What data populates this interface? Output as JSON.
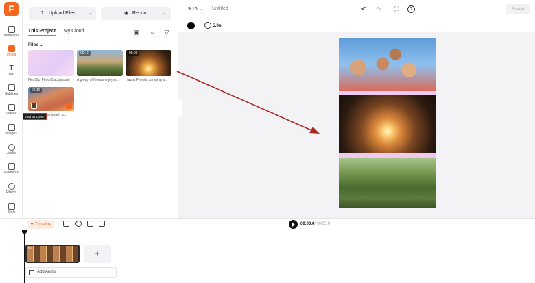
{
  "app": {
    "logo_letter": "F",
    "brand_color": "#f5671f"
  },
  "rail": {
    "items": [
      {
        "label": "Templates",
        "icon": "templates-icon"
      },
      {
        "label": "Media",
        "icon": "media-icon",
        "active": true
      },
      {
        "label": "Text",
        "icon": "text-icon"
      },
      {
        "label": "Subtitles",
        "icon": "subtitles-icon"
      },
      {
        "label": "Videos",
        "icon": "videos-icon"
      },
      {
        "label": "Images",
        "icon": "images-icon"
      },
      {
        "label": "Audio",
        "icon": "audio-icon"
      },
      {
        "label": "Elements",
        "icon": "elements-icon"
      },
      {
        "label": "Effects",
        "icon": "effects-icon"
      },
      {
        "label": "Tools",
        "icon": "tools-icon"
      }
    ]
  },
  "panel": {
    "upload_label": "Upload Files",
    "record_label": "Record",
    "tabs": [
      "This Project",
      "My Cloud"
    ],
    "files_label": "Files",
    "files": [
      {
        "caption": "FlexClip Photo Background",
        "duration": ""
      },
      {
        "caption": "A group of friends enjoym...",
        "duration": "00:12"
      },
      {
        "caption": "Happy Friends Jumping a...",
        "duration": "00:09"
      },
      {
        "caption": "...oying beach fu...",
        "duration": "00:10"
      }
    ],
    "tooltip": "Add as Layer"
  },
  "topbar": {
    "ratio": "9:16",
    "title": "Untitled",
    "saved_label": "Saved"
  },
  "subbar": {
    "duration": "5.0s",
    "bg_color": "#000000"
  },
  "timeline": {
    "label": "Timeline",
    "current_time": "00:00.0",
    "total_time": "/ 00:05.0",
    "clip_label": "01",
    "add_audio_label": "Add Audio"
  }
}
